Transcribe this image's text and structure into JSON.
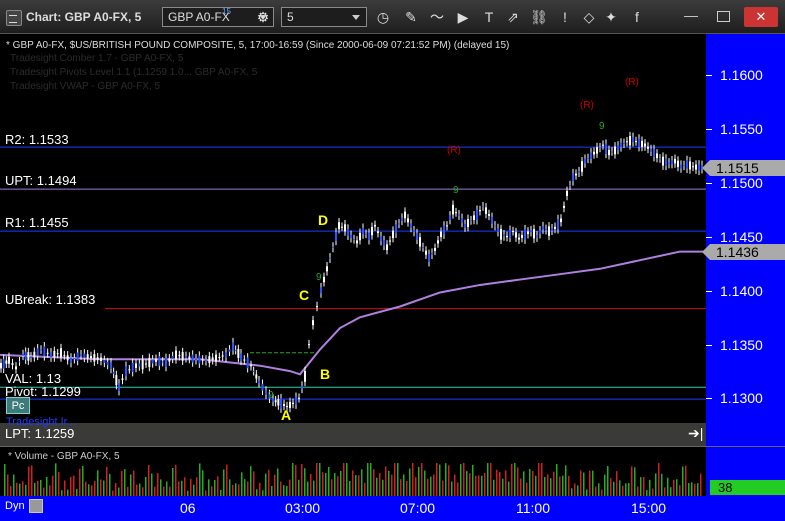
{
  "window": {
    "title": "Chart: GBP A0-FX, 5",
    "symbol_value": "GBP A0-FX",
    "symbol_superscript": "15",
    "interval_value": "5",
    "close_label": "✕",
    "minimize_label": "—"
  },
  "toolbar_icons": [
    "gear-icon",
    "clock-icon",
    "pencil-icon",
    "chart-line-icon",
    "play-icon",
    "text-icon",
    "share-icon",
    "link-icon",
    "alert-icon",
    "tag-icon",
    "twitter-icon",
    "facebook-icon"
  ],
  "chart_header": "* GBP A0-FX, $US/BRITISH POUND COMPOSITE, 5, 17:00-16:59 (Since 2000-06-09 07:21:52 PM) (delayed 15)",
  "ghost_lines": [
    "Tradesight Comber 1.7 - GBP A0-FX, 5",
    "Tradesight Pivots Level 1.1 (1.1259 1.0... GBP A0-FX, 5",
    "Tradesight VWAP - GBP A0-FX, 5"
  ],
  "levels": {
    "r2": "R2: 1.1533",
    "upt": "UPT: 1.1494",
    "r1": "R1: 1.1455",
    "ubreak": "UBreak: 1.1383",
    "val": "VAL: 1.13",
    "pivot": "Pivot: 1.1299",
    "lpt": "LPT: 1.1259",
    "pc_label": "Pc",
    "blue_label": "Tradesight Ir..."
  },
  "points": {
    "A": "A",
    "B": "B",
    "C": "C",
    "D": "D"
  },
  "markers": {
    "r": "(R)",
    "nine": "9"
  },
  "price_axis": {
    "labels": [
      "1.1600",
      "1.1550",
      "1.1500",
      "1.1450",
      "1.1400",
      "1.1350",
      "1.1300"
    ],
    "last_price": "1.1515",
    "vwap_price": "1.1436"
  },
  "volume": {
    "header": "* Volume - GBP A0-FX, 5",
    "current": "38"
  },
  "time_axis": {
    "labels": [
      "06",
      "03:00",
      "07:00",
      "11:00",
      "15:00"
    ],
    "dyn_label": "Dyn"
  },
  "chart_data": {
    "type": "candlestick",
    "ylim": [
      1.1275,
      1.163
    ],
    "y_ticks": [
      1.16,
      1.155,
      1.15,
      1.145,
      1.14,
      1.135,
      1.13
    ],
    "x_ticks": [
      "06",
      "03:00",
      "07:00",
      "11:00",
      "15:00"
    ],
    "levels": [
      {
        "name": "R2",
        "value": 1.1533
      },
      {
        "name": "UPT",
        "value": 1.1494
      },
      {
        "name": "R1",
        "value": 1.1455
      },
      {
        "name": "UBreak",
        "value": 1.1383
      },
      {
        "name": "Pivot",
        "value": 1.1299
      },
      {
        "name": "VAL",
        "value": 1.131
      }
    ],
    "price_path": [
      [
        0,
        1.133
      ],
      [
        8,
        1.1335
      ],
      [
        15,
        1.1328
      ],
      [
        22,
        1.134
      ],
      [
        30,
        1.1338
      ],
      [
        40,
        1.1345
      ],
      [
        50,
        1.134
      ],
      [
        60,
        1.1342
      ],
      [
        70,
        1.1335
      ],
      [
        80,
        1.134
      ],
      [
        90,
        1.1338
      ],
      [
        100,
        1.1336
      ],
      [
        110,
        1.133
      ],
      [
        118,
        1.131
      ],
      [
        125,
        1.1325
      ],
      [
        135,
        1.133
      ],
      [
        145,
        1.1332
      ],
      [
        155,
        1.1335
      ],
      [
        165,
        1.1333
      ],
      [
        175,
        1.134
      ],
      [
        185,
        1.1338
      ],
      [
        195,
        1.1336
      ],
      [
        205,
        1.1335
      ],
      [
        215,
        1.1337
      ],
      [
        225,
        1.134
      ],
      [
        232,
        1.1348
      ],
      [
        240,
        1.1338
      ],
      [
        250,
        1.133
      ],
      [
        258,
        1.1315
      ],
      [
        265,
        1.1305
      ],
      [
        272,
        1.1298
      ],
      [
        280,
        1.1295
      ],
      [
        286,
        1.1292
      ],
      [
        292,
        1.1295
      ],
      [
        298,
        1.13
      ],
      [
        304,
        1.132
      ],
      [
        308,
        1.135
      ],
      [
        312,
        1.137
      ],
      [
        316,
        1.1385
      ],
      [
        320,
        1.14
      ],
      [
        326,
        1.142
      ],
      [
        332,
        1.144
      ],
      [
        338,
        1.146
      ],
      [
        344,
        1.1458
      ],
      [
        350,
        1.145
      ],
      [
        356,
        1.1445
      ],
      [
        362,
        1.1455
      ],
      [
        368,
        1.145
      ],
      [
        374,
        1.146
      ],
      [
        380,
        1.1448
      ],
      [
        386,
        1.144
      ],
      [
        392,
        1.1452
      ],
      [
        398,
        1.1462
      ],
      [
        404,
        1.147
      ],
      [
        410,
        1.146
      ],
      [
        416,
        1.145
      ],
      [
        422,
        1.144
      ],
      [
        428,
        1.143
      ],
      [
        434,
        1.1438
      ],
      [
        440,
        1.1452
      ],
      [
        446,
        1.146
      ],
      [
        452,
        1.1475
      ],
      [
        458,
        1.147
      ],
      [
        464,
        1.146
      ],
      [
        470,
        1.1465
      ],
      [
        476,
        1.147
      ],
      [
        482,
        1.1478
      ],
      [
        488,
        1.147
      ],
      [
        494,
        1.146
      ],
      [
        500,
        1.1452
      ],
      [
        506,
        1.145
      ],
      [
        512,
        1.1455
      ],
      [
        518,
        1.1448
      ],
      [
        524,
        1.1452
      ],
      [
        530,
        1.1455
      ],
      [
        536,
        1.145
      ],
      [
        542,
        1.1458
      ],
      [
        548,
        1.1455
      ],
      [
        554,
        1.1458
      ],
      [
        560,
        1.1465
      ],
      [
        566,
        1.149
      ],
      [
        572,
        1.1505
      ],
      [
        578,
        1.151
      ],
      [
        584,
        1.152
      ],
      [
        590,
        1.1525
      ],
      [
        596,
        1.153
      ],
      [
        602,
        1.1535
      ],
      [
        608,
        1.1528
      ],
      [
        614,
        1.153
      ],
      [
        620,
        1.1535
      ],
      [
        626,
        1.1538
      ],
      [
        632,
        1.154
      ],
      [
        638,
        1.1537
      ],
      [
        644,
        1.1535
      ],
      [
        650,
        1.153
      ],
      [
        656,
        1.1525
      ],
      [
        662,
        1.152
      ],
      [
        668,
        1.1518
      ],
      [
        674,
        1.152
      ],
      [
        680,
        1.1515
      ],
      [
        686,
        1.1517
      ],
      [
        692,
        1.1515
      ],
      [
        698,
        1.1514
      ],
      [
        704,
        1.1515
      ]
    ],
    "vwap_path": [
      [
        0,
        1.134
      ],
      [
        100,
        1.1336
      ],
      [
        200,
        1.1336
      ],
      [
        260,
        1.133
      ],
      [
        290,
        1.1325
      ],
      [
        300,
        1.1322
      ],
      [
        320,
        1.1345
      ],
      [
        340,
        1.1365
      ],
      [
        360,
        1.1375
      ],
      [
        400,
        1.1385
      ],
      [
        440,
        1.1398
      ],
      [
        480,
        1.1405
      ],
      [
        520,
        1.141
      ],
      [
        560,
        1.1415
      ],
      [
        600,
        1.142
      ],
      [
        640,
        1.1428
      ],
      [
        680,
        1.1436
      ],
      [
        704,
        1.1436
      ]
    ]
  }
}
